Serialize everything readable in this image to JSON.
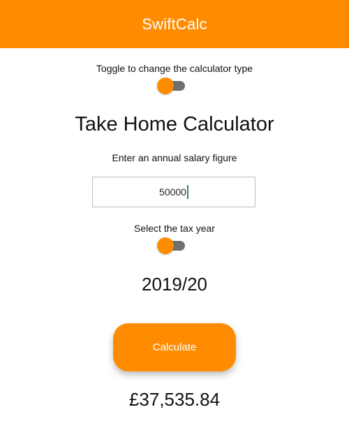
{
  "app": {
    "title": "SwiftCalc",
    "accent_color": "#ff8c00"
  },
  "calc_type_toggle": {
    "label": "Toggle to change the calculator type",
    "state": "off"
  },
  "calculator": {
    "heading": "Take Home Calculator",
    "salary_label": "Enter an annual salary figure",
    "salary_value": "50000",
    "tax_year_label": "Select the tax year",
    "tax_year_toggle_state": "off",
    "tax_year_value": "2019/20",
    "calculate_label": "Calculate",
    "result": "£37,535.84"
  }
}
